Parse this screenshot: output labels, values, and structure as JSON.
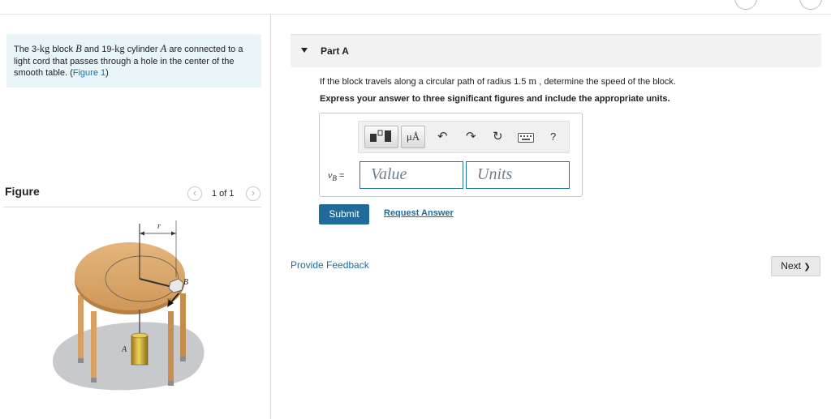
{
  "problem": {
    "intro_prefix": "The 3-",
    "unit_kg_1": "kg",
    "text_2": " block ",
    "var_B": "B",
    "text_3": " and 19-",
    "unit_kg_2": "kg",
    "text_4": " cylinder ",
    "var_A": "A",
    "text_5": " are connected to a light cord that passes through a hole in the center of the smooth table. (",
    "figure_link": "Figure 1",
    "text_6": ")"
  },
  "figure": {
    "title": "Figure",
    "prev_icon": "chevron-left-icon",
    "next_icon": "chevron-right-icon",
    "prev_glyph": "‹",
    "next_glyph": "›",
    "count": "1 of 1",
    "labels": {
      "r": "r",
      "B": "B",
      "A": "A",
      "v": "v"
    }
  },
  "part": {
    "title": "Part A",
    "collapse_icon": "triangle-down-icon",
    "question_prefix": "If the block travels along a circular path of radius 1.5 ",
    "question_unit": "m",
    "question_suffix": " , determine the speed of the block.",
    "instruction": "Express your answer to three significant figures and include the appropriate units."
  },
  "toolbar": {
    "templates_icon": "templates-icon",
    "units_icon": "units-mu-angstrom-icon",
    "units_glyph": "μÅ",
    "undo_icon": "undo-icon",
    "undo_glyph": "↶",
    "redo_icon": "redo-icon",
    "redo_glyph": "↷",
    "reset_icon": "reset-icon",
    "reset_glyph": "↻",
    "keyboard_icon": "keyboard-icon",
    "help_icon": "help-icon",
    "help_glyph": "?"
  },
  "answer": {
    "variable": "v",
    "subscript": "B",
    "equals": " =",
    "value_placeholder": "Value",
    "units_placeholder": "Units"
  },
  "actions": {
    "submit": "Submit",
    "request_answer": "Request Answer",
    "provide_feedback": "Provide Feedback",
    "next": "Next",
    "next_glyph": "❯"
  },
  "colors": {
    "accent": "#1f6b99",
    "intro_bg": "#e8f4f8",
    "table_top": "#d8a468",
    "table_edge": "#b77f42",
    "shadow": "#c7c9cc"
  }
}
